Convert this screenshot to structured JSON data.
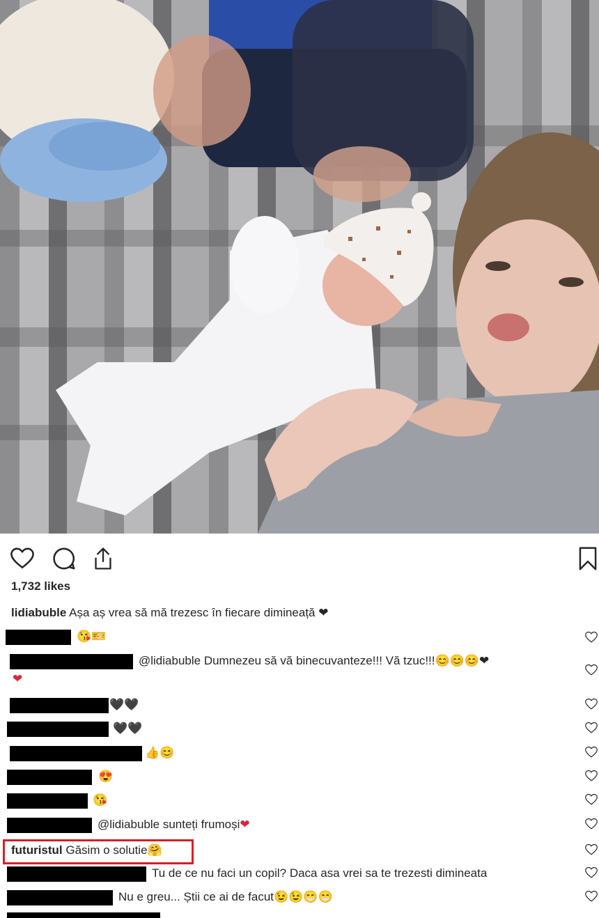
{
  "post": {
    "likes": "1,732 likes",
    "caption": {
      "username": "lidiabuble",
      "text": " Așa aș vrea să mă trezesc în fiecare dimineață ❤"
    }
  },
  "icons": {
    "like": "heart-outline-icon",
    "comment": "comment-bubble-icon",
    "share": "share-icon",
    "save": "bookmark-icon",
    "comment_like": "small-heart-outline-icon"
  },
  "comments": [
    {
      "text": "",
      "emoji": "😘🎫"
    },
    {
      "text": "@lidiabuble Dumnezeu să vă binecuvanteze!!! Vă tzuc!!!",
      "emoji": "😊😊😊❤",
      "continued": "❤"
    },
    {
      "text": "",
      "emoji": "🖤🖤"
    },
    {
      "text": "",
      "emoji": "🖤🖤"
    },
    {
      "text": "",
      "emoji": "👍😊"
    },
    {
      "text": "",
      "emoji": "😍"
    },
    {
      "text": "",
      "emoji": "😘"
    },
    {
      "text": "@lidiabuble sunteți frumoși",
      "emoji": "❤"
    },
    {
      "username": "futuristul",
      "text": " Găsim o solutie",
      "emoji": "🤗"
    },
    {
      "text": "Tu de ce nu faci un copil? Daca asa vrei sa te trezesti dimineata",
      "emoji": ""
    },
    {
      "text": "Nu e greu... Știi ce ai de facut",
      "emoji": "😉😉😁😁"
    }
  ],
  "colors": {
    "highlight_border": "#d32029",
    "redaction": "#000000",
    "text": "#262626"
  }
}
